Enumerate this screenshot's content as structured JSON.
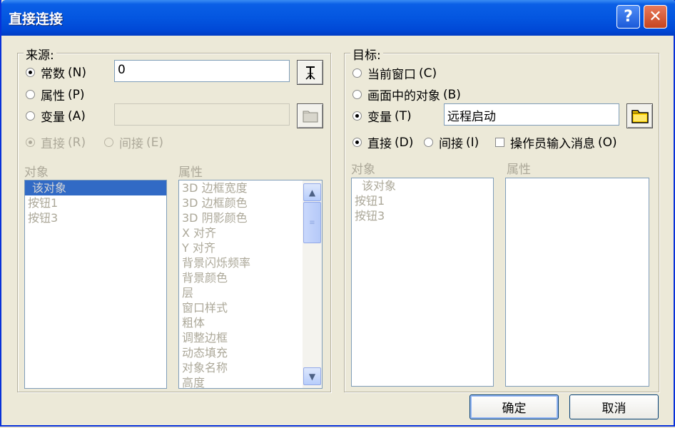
{
  "window": {
    "title": "直接连接"
  },
  "source": {
    "label": "来源:",
    "options": [
      {
        "label": "常数",
        "shortcut": "(N)",
        "checked": true,
        "enabled": true
      },
      {
        "label": "属性",
        "shortcut": "(P)",
        "checked": false,
        "enabled": true
      },
      {
        "label": "变量",
        "shortcut": "(A)",
        "checked": false,
        "enabled": true
      }
    ],
    "constant_value": "0",
    "variable_value": "",
    "direct": {
      "label": "直接",
      "shortcut": "(R)",
      "checked": true,
      "enabled": false
    },
    "indirect": {
      "label": "间接",
      "shortcut": "(E)",
      "checked": false,
      "enabled": false
    },
    "objects_header": "对象",
    "properties_header": "属性",
    "objects": [
      "该对象",
      "按钮1",
      "按钮3"
    ],
    "properties": [
      "3D 边框宽度",
      "3D 边框颜色",
      "3D 阴影颜色",
      "X 对齐",
      "Y 对齐",
      "背景闪烁频率",
      "背景颜色",
      "层",
      "窗口样式",
      "粗体",
      "调整边框",
      "动态填充",
      "对象名称",
      "高度"
    ]
  },
  "target": {
    "label": "目标:",
    "options": [
      {
        "label": "当前窗口",
        "shortcut": "(C)",
        "checked": false
      },
      {
        "label": "画面中的对象",
        "shortcut": "(B)",
        "checked": false
      },
      {
        "label": "变量",
        "shortcut": "(T)",
        "checked": true
      }
    ],
    "variable_value": "远程启动",
    "direct": {
      "label": "直接",
      "shortcut": "(D)",
      "checked": true
    },
    "indirect": {
      "label": "间接",
      "shortcut": "(I)",
      "checked": false
    },
    "operator_msg": {
      "label": "操作员输入消息",
      "shortcut": "(O)",
      "checked": false
    },
    "objects_header": "对象",
    "properties_header": "属性",
    "objects": [
      "该对象",
      "按钮1",
      "按钮3"
    ]
  },
  "buttons": {
    "ok": "确定",
    "cancel": "取消"
  },
  "icons": {
    "help": "?",
    "close": "✕"
  }
}
